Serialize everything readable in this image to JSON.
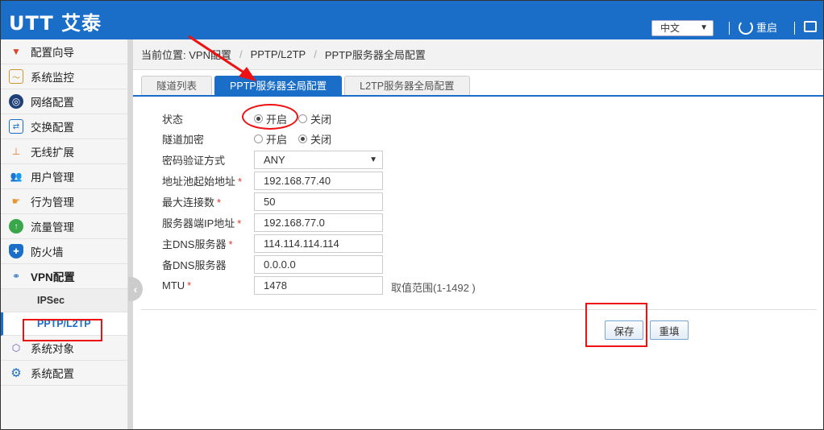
{
  "header": {
    "logo": "UTT 艾泰",
    "language": "中文",
    "restart_label": "重启"
  },
  "sidebar": {
    "items": [
      {
        "label": "配置向导",
        "icon": "wizard-icon"
      },
      {
        "label": "系统监控",
        "icon": "monitor-icon"
      },
      {
        "label": "网络配置",
        "icon": "network-icon"
      },
      {
        "label": "交换配置",
        "icon": "switch-icon"
      },
      {
        "label": "无线扩展",
        "icon": "wireless-icon"
      },
      {
        "label": "用户管理",
        "icon": "users-icon"
      },
      {
        "label": "行为管理",
        "icon": "hand-icon"
      },
      {
        "label": "流量管理",
        "icon": "traffic-icon"
      },
      {
        "label": "防火墙",
        "icon": "shield-icon"
      },
      {
        "label": "VPN配置",
        "icon": "vpn-icon"
      },
      {
        "label": "系统对象",
        "icon": "cube-icon"
      },
      {
        "label": "系统配置",
        "icon": "gear-icon"
      }
    ],
    "vpn_sub": [
      {
        "label": "IPSec"
      },
      {
        "label": "PPTP/L2TP"
      }
    ]
  },
  "breadcrumb": {
    "prefix": "当前位置: VPN配置",
    "level2": "PPTP/L2TP",
    "level3": "PPTP服务器全局配置"
  },
  "tabs": [
    {
      "label": "隧道列表"
    },
    {
      "label": "PPTP服务器全局配置"
    },
    {
      "label": "L2TP服务器全局配置"
    }
  ],
  "form": {
    "status": {
      "label": "状态",
      "on": "开启",
      "off": "关闭",
      "value": "on"
    },
    "tunnel_encrypt": {
      "label": "隧道加密",
      "on": "开启",
      "off": "关闭",
      "value": "off"
    },
    "auth_method": {
      "label": "密码验证方式",
      "value": "ANY"
    },
    "pool_start": {
      "label": "地址池起始地址",
      "value": "192.168.77.40"
    },
    "max_conn": {
      "label": "最大连接数",
      "value": "50"
    },
    "server_ip": {
      "label": "服务器端IP地址",
      "value": "192.168.77.0"
    },
    "primary_dns": {
      "label": "主DNS服务器",
      "value": "114.114.114.114"
    },
    "secondary_dns": {
      "label": "备DNS服务器",
      "value": "0.0.0.0"
    },
    "mtu": {
      "label": "MTU",
      "value": "1478",
      "hint": "取值范围(1-1492 )"
    },
    "required_mark": "*"
  },
  "buttons": {
    "save": "保存",
    "reset": "重填"
  },
  "colors": {
    "brand": "#1a6ec8",
    "annotation": "#e11111"
  }
}
